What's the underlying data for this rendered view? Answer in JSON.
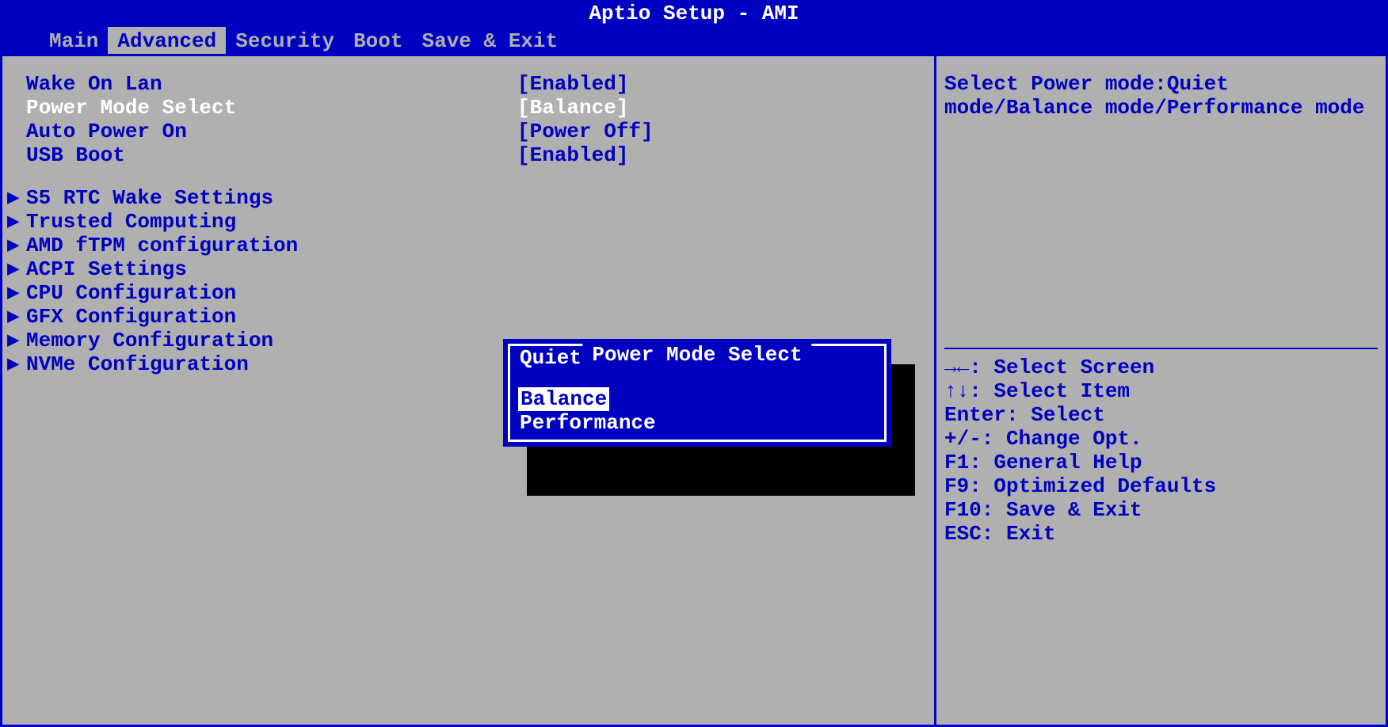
{
  "header": {
    "title": "Aptio Setup - AMI"
  },
  "tabs": [
    {
      "label": "Main",
      "active": false
    },
    {
      "label": "Advanced",
      "active": true
    },
    {
      "label": "Security",
      "active": false
    },
    {
      "label": "Boot",
      "active": false
    },
    {
      "label": "Save & Exit",
      "active": false
    }
  ],
  "settings": [
    {
      "label": "Wake On Lan",
      "value": "[Enabled]",
      "selected": false
    },
    {
      "label": "Power Mode Select",
      "value": "[Balance]",
      "selected": true
    },
    {
      "label": "Auto Power On",
      "value": "[Power Off]",
      "selected": false
    },
    {
      "label": "USB Boot",
      "value": "[Enabled]",
      "selected": false
    }
  ],
  "submenus": [
    {
      "label": "S5 RTC Wake Settings"
    },
    {
      "label": "Trusted Computing"
    },
    {
      "label": "AMD fTPM configuration"
    },
    {
      "label": "ACPI Settings"
    },
    {
      "label": "CPU Configuration"
    },
    {
      "label": "GFX Configuration"
    },
    {
      "label": "Memory Configuration"
    },
    {
      "label": "NVMe Configuration"
    }
  ],
  "helpText": "Select Power mode:Quiet mode/Balance mode/Performance mode",
  "keyHints": [
    "→←: Select Screen",
    "↑↓: Select Item",
    "Enter: Select",
    "+/-: Change Opt.",
    "F1: General Help",
    "F9: Optimized Defaults",
    "F10: Save & Exit",
    "ESC: Exit"
  ],
  "popup": {
    "title": "Power Mode Select",
    "options": [
      {
        "label": "Quiet",
        "highlighted": false
      },
      {
        "label": "Balance",
        "highlighted": true
      },
      {
        "label": "Performance",
        "highlighted": false
      }
    ]
  }
}
